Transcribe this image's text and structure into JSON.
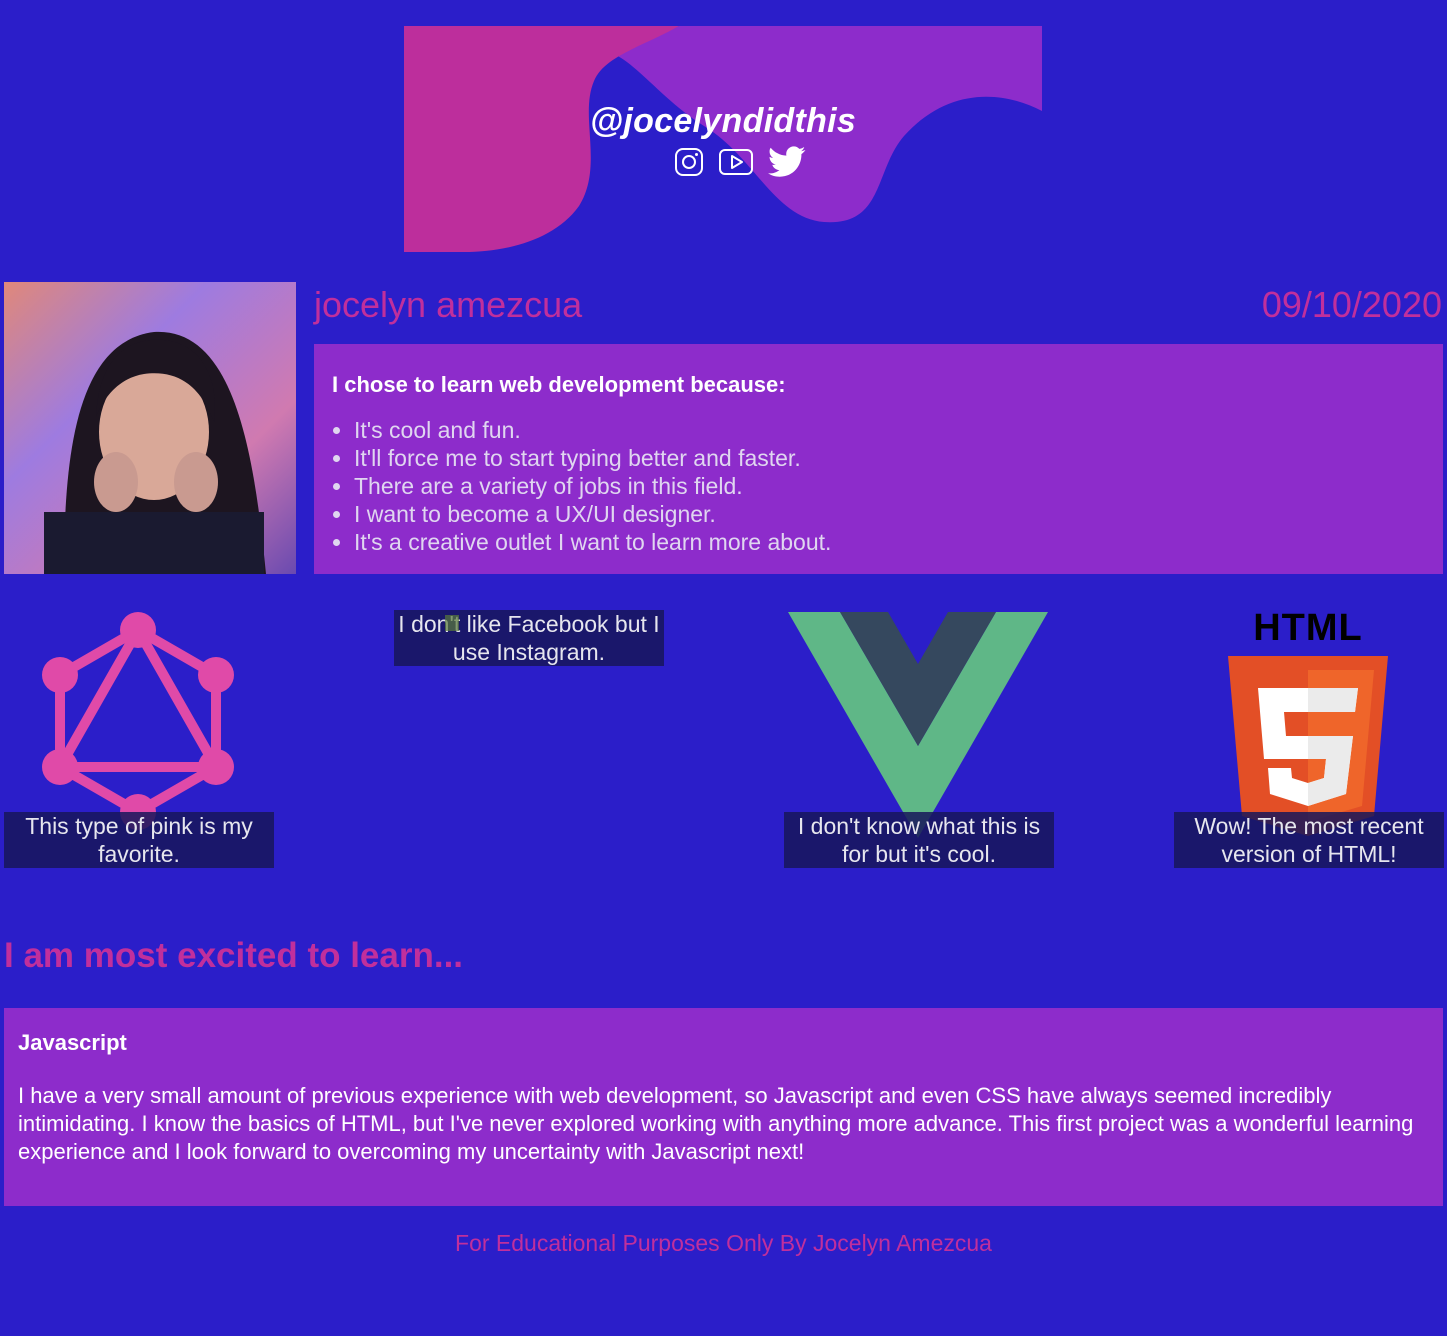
{
  "banner": {
    "handle": "@jocelyndidthis",
    "icons": [
      "instagram-icon",
      "youtube-icon",
      "twitter-icon"
    ],
    "colors": {
      "pink": "#bd2e9c",
      "purple": "#8d2ccb",
      "blue": "#2b1ec9"
    }
  },
  "profile": {
    "name": "jocelyn amezcua",
    "date": "09/10/2020",
    "reasons_title": "I chose to learn web development because:",
    "reasons": [
      "It's cool and fun.",
      "It'll force me to start typing better and faster.",
      "There are a variety of jobs in this field.",
      "I want to become a UX/UI designer.",
      "It's a creative outlet I want to learn more about."
    ]
  },
  "logos": [
    {
      "icon": "graphql-icon",
      "caption": "This type of pink is my favorite."
    },
    {
      "icon": "broken-image-icon",
      "caption": "I don't like Facebook but I use Instagram."
    },
    {
      "icon": "vue-icon",
      "caption": "I don't know what this is for but it's cool."
    },
    {
      "icon": "html5-icon",
      "label": "HTML",
      "caption": "Wow! The most recent version of HTML!"
    }
  ],
  "excited": {
    "heading": "I am most excited to learn...",
    "title": "Javascript",
    "body": "I have a very small amount of previous experience with web development, so Javascript and even CSS have always seemed incredibly intimidating. I know the basics of HTML, but I've never explored working with anything more advance. This first project was a wonderful learning experience and I look forward to overcoming my uncertainty with Javascript next!"
  },
  "footer": {
    "text": "For Educational Purposes Only By Jocelyn Amezcua"
  }
}
